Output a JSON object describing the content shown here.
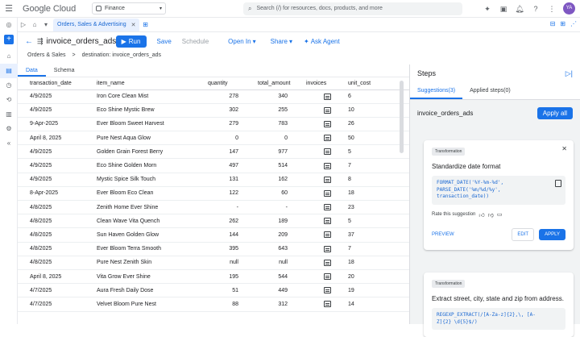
{
  "topbar": {
    "logo_google": "Google",
    "logo_cloud": "Cloud",
    "project": "Finance",
    "search_placeholder": "Search (/) for resources, docs, products, and more",
    "avatar": "YA",
    "icons": [
      "gemini-icon",
      "terminal-icon",
      "notifications-icon",
      "help-icon",
      "settings-icon"
    ]
  },
  "tabstrip": {
    "tab_label": "Orders, Sales & Advertising"
  },
  "toolbar": {
    "title": "invoice_orders_ads",
    "run": "Run",
    "save": "Save",
    "schedule": "Schedule",
    "open_in": "Open In",
    "share": "Share",
    "ask_agent": "Ask Agent"
  },
  "breadcrumb": {
    "parent": "Orders & Sales",
    "sep": ">",
    "current": "destination: invoice_orders_ads"
  },
  "subtabs": [
    "Data",
    "Schema"
  ],
  "table": {
    "columns": [
      "transaction_date",
      "item_name",
      "quantity",
      "total_amount",
      "invoices",
      "unit_cost"
    ],
    "rows": [
      [
        "4/9/2025",
        "Iron Core Clean Mist",
        "278",
        "340",
        "6"
      ],
      [
        "4/9/2025",
        "Eco Shine Mystic Brew",
        "302",
        "255",
        "10"
      ],
      [
        "9-Apr-2025",
        "Ever Bloom Sweet Harvest",
        "279",
        "783",
        "26"
      ],
      [
        "April 8, 2025",
        "Pure Nest Aqua Glow",
        "0",
        "0",
        "50"
      ],
      [
        "4/9/2025",
        "Golden Grain Forest Berry",
        "147",
        "977",
        "5"
      ],
      [
        "4/9/2025",
        "Eco Shine Golden Morn",
        "497",
        "514",
        "7"
      ],
      [
        "4/9/2025",
        "Mystic Spice Silk Touch",
        "131",
        "162",
        "8"
      ],
      [
        "8-Apr-2025",
        "Ever Bloom Eco Clean",
        "122",
        "60",
        "18"
      ],
      [
        "4/8/2025",
        "Zenith Home Ever Shine",
        "-",
        "-",
        "23"
      ],
      [
        "4/8/2025",
        "Clean Wave Vita Quench",
        "262",
        "189",
        "5"
      ],
      [
        "4/8/2025",
        "Sun Haven Golden Glow",
        "144",
        "209",
        "37"
      ],
      [
        "4/8/2025",
        "Ever Bloom Terra Smooth",
        "395",
        "643",
        "7"
      ],
      [
        "4/8/2025",
        "Pure Nest Zenith Skin",
        "null",
        "null",
        "18"
      ],
      [
        "April 8, 2025",
        "Vita Grow Ever Shine",
        "195",
        "544",
        "20"
      ],
      [
        "4/7/2025",
        "Aura Fresh Daily Dose",
        "51",
        "449",
        "19"
      ],
      [
        "4/7/2025",
        "Velvet Bloom Pure Nest",
        "88",
        "312",
        "14"
      ]
    ]
  },
  "steps": {
    "title": "Steps",
    "tab_suggestions": "Suggestions(3)",
    "tab_applied": "Applied steps(0)",
    "source": "invoice_orders_ads",
    "apply_all": "Apply all",
    "cards": [
      {
        "chip": "Transformation",
        "title": "Standardize date format",
        "code": "FORMAT_DATE('%Y-%m-%d',\nPARSE_DATE('%m/%d/%y',\ntransaction_date))",
        "rate": "Rate this suggestion",
        "preview": "PREVIEW",
        "edit": "EDIT",
        "apply": "APPLY"
      },
      {
        "chip": "Transformation",
        "title": "Extract street, city, state and zip from address.",
        "code": "REGEXP_EXTRACT(/[A-Za-z]{2},\\, [A-\nZ]{2} \\d{5}$/)"
      }
    ]
  }
}
